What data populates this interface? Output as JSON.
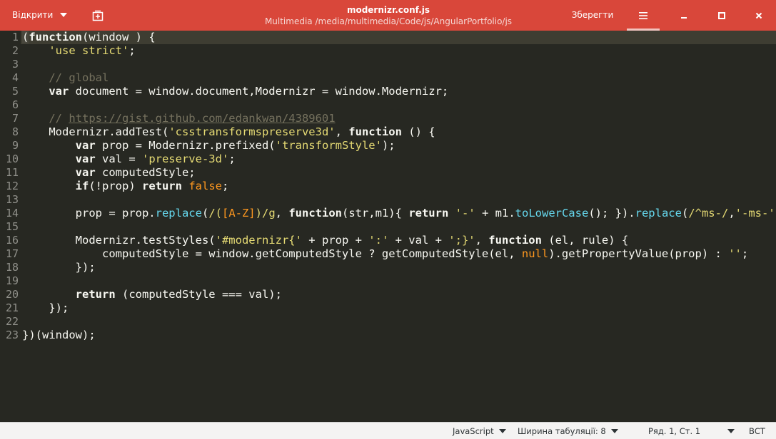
{
  "header": {
    "open_label": "Відкрити",
    "title": "modernizr.conf.js",
    "subtitle": "Multimedia /media/multimedia/Code/js/AngularPortfolio/js",
    "save_label": "Зберегти",
    "bg_color": "#d9473a"
  },
  "editor": {
    "line_numbers": [
      "1",
      "2",
      "3",
      "4",
      "5",
      "6",
      "7",
      "8",
      "9",
      "10",
      "11",
      "12",
      "13",
      "14",
      "15",
      "16",
      "17",
      "18",
      "19",
      "20",
      "21",
      "22",
      "23"
    ],
    "theme": {
      "bg": "#272822",
      "current_line": "#3e3d32",
      "string": "#e6db74",
      "comment": "#75715e",
      "builtin": "#66d9ef",
      "constant": "#ae81ff",
      "null": "#fd971f"
    },
    "lines": [
      [
        {
          "t": "(",
          "c": "paren-match"
        },
        {
          "t": "function",
          "c": "kw"
        },
        {
          "t": "(window ) {",
          "c": ""
        }
      ],
      [
        {
          "t": "    ",
          "c": ""
        },
        {
          "t": "'use strict'",
          "c": "str"
        },
        {
          "t": ";",
          "c": ""
        }
      ],
      [],
      [
        {
          "t": "    ",
          "c": ""
        },
        {
          "t": "// global",
          "c": "cm"
        }
      ],
      [
        {
          "t": "    ",
          "c": ""
        },
        {
          "t": "var",
          "c": "kw"
        },
        {
          "t": " document = window.document,Modernizr = window.Modernizr;",
          "c": ""
        }
      ],
      [],
      [
        {
          "t": "    ",
          "c": ""
        },
        {
          "t": "// ",
          "c": "cm"
        },
        {
          "t": "https://gist.github.com/edankwan/4389601",
          "c": "cm-link"
        }
      ],
      [
        {
          "t": "    Modernizr.addTest(",
          "c": ""
        },
        {
          "t": "'csstransformspreserve3d'",
          "c": "str"
        },
        {
          "t": ", ",
          "c": ""
        },
        {
          "t": "function",
          "c": "kw"
        },
        {
          "t": " () {",
          "c": ""
        }
      ],
      [
        {
          "t": "        ",
          "c": ""
        },
        {
          "t": "var",
          "c": "kw"
        },
        {
          "t": " prop = Modernizr.prefixed(",
          "c": ""
        },
        {
          "t": "'transformStyle'",
          "c": "str"
        },
        {
          "t": ");",
          "c": ""
        }
      ],
      [
        {
          "t": "        ",
          "c": ""
        },
        {
          "t": "var",
          "c": "kw"
        },
        {
          "t": " val = ",
          "c": ""
        },
        {
          "t": "'preserve-3d'",
          "c": "str"
        },
        {
          "t": ";",
          "c": ""
        }
      ],
      [
        {
          "t": "        ",
          "c": ""
        },
        {
          "t": "var",
          "c": "kw"
        },
        {
          "t": " computedStyle;",
          "c": ""
        }
      ],
      [
        {
          "t": "        ",
          "c": ""
        },
        {
          "t": "if",
          "c": "kw"
        },
        {
          "t": "(!prop) ",
          "c": ""
        },
        {
          "t": "return",
          "c": "kw"
        },
        {
          "t": " ",
          "c": ""
        },
        {
          "t": "false",
          "c": "null"
        },
        {
          "t": ";",
          "c": ""
        }
      ],
      [],
      [
        {
          "t": "        prop = prop.",
          "c": ""
        },
        {
          "t": "replace",
          "c": "fn"
        },
        {
          "t": "(",
          "c": ""
        },
        {
          "t": "/(",
          "c": "rx"
        },
        {
          "t": "[A-Z]",
          "c": "rx-class"
        },
        {
          "t": ")/g",
          "c": "rx"
        },
        {
          "t": ", ",
          "c": ""
        },
        {
          "t": "function",
          "c": "kw"
        },
        {
          "t": "(str,m1){ ",
          "c": ""
        },
        {
          "t": "return",
          "c": "kw"
        },
        {
          "t": " ",
          "c": ""
        },
        {
          "t": "'-'",
          "c": "str"
        },
        {
          "t": " + m1.",
          "c": ""
        },
        {
          "t": "toLowerCase",
          "c": "fn"
        },
        {
          "t": "(); }).",
          "c": ""
        },
        {
          "t": "replace",
          "c": "fn"
        },
        {
          "t": "(",
          "c": ""
        },
        {
          "t": "/^ms-/",
          "c": "rx"
        },
        {
          "t": ",",
          "c": ""
        },
        {
          "t": "'-ms-'",
          "c": "str"
        },
        {
          "t": ");",
          "c": ""
        }
      ],
      [],
      [
        {
          "t": "        Modernizr.testStyles(",
          "c": ""
        },
        {
          "t": "'#modernizr{'",
          "c": "str"
        },
        {
          "t": " + prop + ",
          "c": ""
        },
        {
          "t": "':'",
          "c": "str"
        },
        {
          "t": " + val + ",
          "c": ""
        },
        {
          "t": "';}'",
          "c": "str"
        },
        {
          "t": ", ",
          "c": ""
        },
        {
          "t": "function",
          "c": "kw"
        },
        {
          "t": " (el, rule) {",
          "c": ""
        }
      ],
      [
        {
          "t": "            computedStyle = window.getComputedStyle ? getComputedStyle(el, ",
          "c": ""
        },
        {
          "t": "null",
          "c": "null"
        },
        {
          "t": ").getPropertyValue(prop) : ",
          "c": ""
        },
        {
          "t": "''",
          "c": "str"
        },
        {
          "t": ";",
          "c": ""
        }
      ],
      [
        {
          "t": "        });",
          "c": ""
        }
      ],
      [],
      [
        {
          "t": "        ",
          "c": ""
        },
        {
          "t": "return",
          "c": "kw"
        },
        {
          "t": " (computedStyle === val);",
          "c": ""
        }
      ],
      [
        {
          "t": "    });",
          "c": ""
        }
      ],
      [],
      [
        {
          "t": "})(window);",
          "c": ""
        }
      ]
    ]
  },
  "status": {
    "language": "JavaScript",
    "tab_width": "Ширина табуляції: 8",
    "position": "Ряд. 1, Ст. 1",
    "mode": "ВСТ"
  }
}
